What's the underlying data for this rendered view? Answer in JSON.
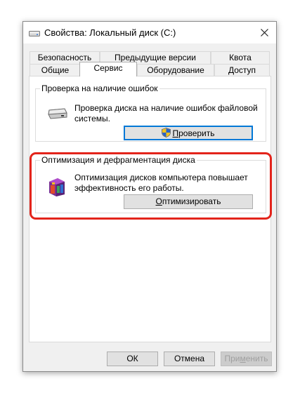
{
  "window": {
    "title": "Свойства: Локальный диск (C:)"
  },
  "tabs": {
    "row1": [
      {
        "label": "Безопасность"
      },
      {
        "label": "Предыдущие версии"
      },
      {
        "label": "Квота"
      }
    ],
    "row2": [
      {
        "label": "Общие"
      },
      {
        "label": "Сервис",
        "active": true
      },
      {
        "label": "Оборудование"
      },
      {
        "label": "Доступ"
      }
    ]
  },
  "error_check": {
    "title": "Проверка на наличие ошибок",
    "description": "Проверка диска на наличие ошибок файловой системы.",
    "button_prefix": "",
    "button_mnemonic": "П",
    "button_rest": "роверить",
    "icon": "drive-icon",
    "button_icon": "uac-shield-icon"
  },
  "optimize": {
    "title": "Оптимизация и дефрагментация диска",
    "description": "Оптимизация дисков компьютера повышает эффективность его работы.",
    "button_mnemonic": "О",
    "button_rest": "птимизировать",
    "icon": "defrag-icon"
  },
  "footer": {
    "ok_label": "ОК",
    "cancel_label": "Отмена",
    "apply_prefix": "При",
    "apply_mnemonic": "м",
    "apply_rest": "енить"
  },
  "colors": {
    "highlight": "#e3241b",
    "focus": "#0078d7"
  }
}
